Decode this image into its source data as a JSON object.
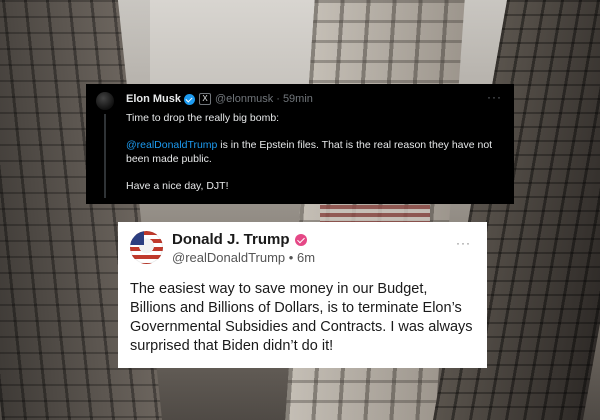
{
  "x_post": {
    "author_name": "Elon Musk",
    "badge": "X",
    "handle": "@elonmusk",
    "separator": "·",
    "time": "59min",
    "more": "···",
    "lines": [
      "Time to drop the really big bomb:",
      "@realDonaldTrump",
      " is in the Epstein files. That is the real reason they have not been made public.",
      "Have a nice day, DJT!"
    ],
    "colors": {
      "background": "#000000",
      "text": "#e7e9ea",
      "link": "#1d9bf0",
      "muted": "#71767b"
    }
  },
  "truth_post": {
    "author_name": "Donald J. Trump",
    "handle": "@realDonaldTrump",
    "separator": "•",
    "time": "6m",
    "more": "···",
    "body": "The easiest way to save money in our Budget, Billions and Billions of Dollars, is to terminate Elon’s Governmental Subsidies and Contracts. I was always surprised that Biden didn’t do it!",
    "colors": {
      "background": "#ffffff",
      "text": "#1a1a1a",
      "verified": "#e54886"
    }
  }
}
